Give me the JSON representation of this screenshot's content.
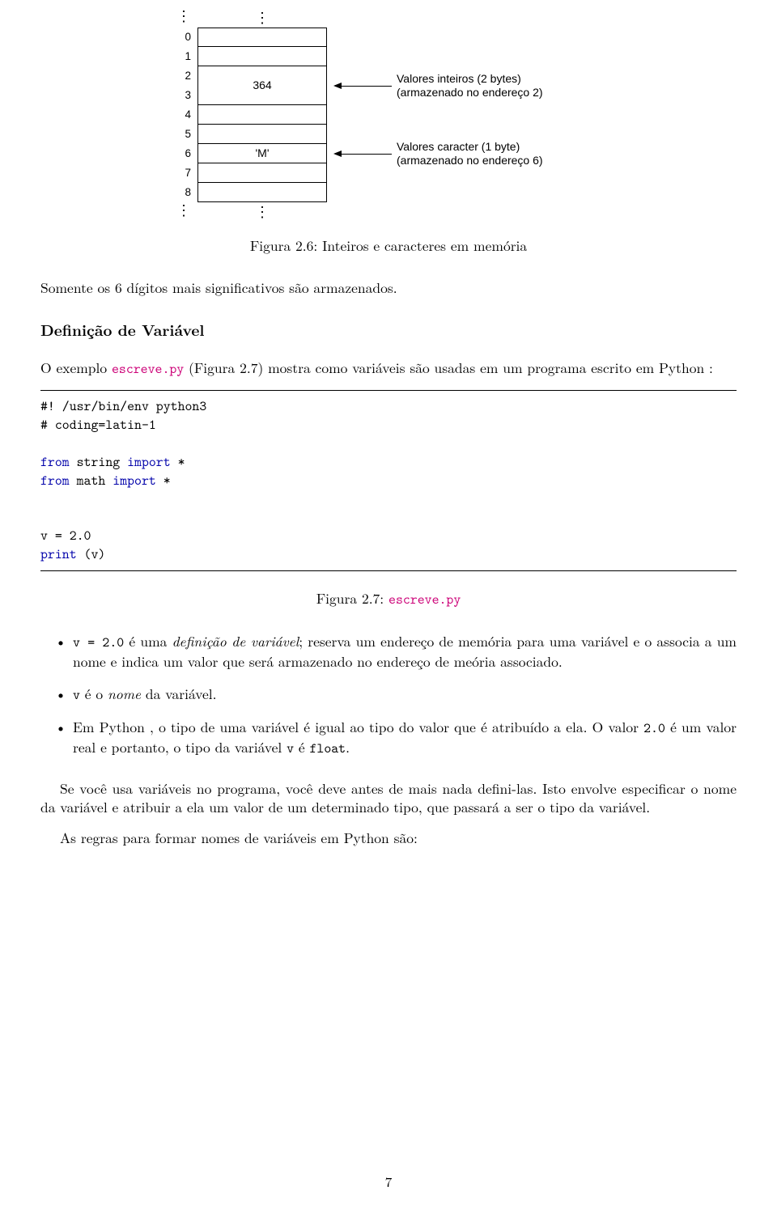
{
  "diagram": {
    "indices": [
      "0",
      "1",
      "2",
      "3",
      "4",
      "5",
      "6",
      "7",
      "8"
    ],
    "cell_23": "364",
    "cell_6": "'M'",
    "arrow1_l1": "Valores inteiros (2 bytes)",
    "arrow1_l2": "(armazenado no endereço 2)",
    "arrow2_l1": "Valores caracter (1 byte)",
    "arrow2_l2": "(armazenado no endereço 6)"
  },
  "caption1": "Figura 2.6: Inteiros e caracteres em memória",
  "p1": "Somente os 6 dígitos mais significativos são armazenados.",
  "section": "Definição de Variável",
  "p2_a": "O exemplo ",
  "p2_link": "escreve.py",
  "p2_b": " (Figura 2.7) mostra como variáveis são usadas em um programa escrito em Python :",
  "code": {
    "l1": "#! /usr/bin/env python3",
    "l2": "# coding=latin-1",
    "l3_a": "from",
    "l3_b": " string ",
    "l3_c": "import",
    "l3_d": " *",
    "l4_a": "from",
    "l4_b": " math ",
    "l4_c": "import",
    "l4_d": " *",
    "l5": "v = 2.0",
    "l6_a": "print",
    "l6_b": " (v)"
  },
  "caption2_a": "Figura 2.7: ",
  "caption2_link": "escreve.py",
  "bullets": {
    "b1_a": "v = 2.0",
    "b1_b": " é uma ",
    "b1_c": "definição de variável",
    "b1_d": "; reserva um endereço de memória para uma variável e o associa a um nome e indica um valor que será armazenado no endereço de meória associado.",
    "b2_a": "v",
    "b2_b": " é o ",
    "b2_c": "nome",
    "b2_d": " da variável.",
    "b3_a": "Em Python , o tipo de uma variável é igual ao tipo do valor que é atribuído a ela. O valor ",
    "b3_b": "2.0",
    "b3_c": " é um valor real e portanto, o tipo da variável ",
    "b3_d": "v",
    "b3_e": " é ",
    "b3_f": "float",
    "b3_g": "."
  },
  "p3": "Se você usa variáveis no programa, você deve antes de mais nada defini-las. Isto envolve especificar o nome da variável e atribuir a ela um valor de um determinado tipo, que passará a ser o tipo da variável.",
  "p4": "As regras para formar nomes de variáveis em Python são:",
  "page_num": "7"
}
